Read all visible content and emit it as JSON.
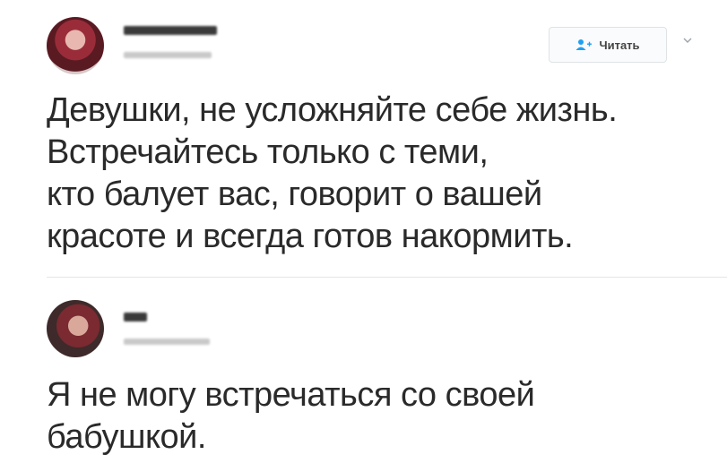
{
  "tweets": [
    {
      "follow_label": "Читать",
      "text": "Девушки, не усложняйте себе жизнь.\nВстречайтесь только с теми,\nкто балует вас, говорит о вашей\nкрасоте и всегда готов накормить."
    },
    {
      "text": "Я не могу встречаться со своей\nбабушкой."
    }
  ],
  "colors": {
    "text": "#2a2a2a",
    "follow_icon": "#1da1f2",
    "divider": "#e3e6e8"
  },
  "icons": {
    "follow": "add-user-icon",
    "caret": "chevron-down-icon"
  }
}
